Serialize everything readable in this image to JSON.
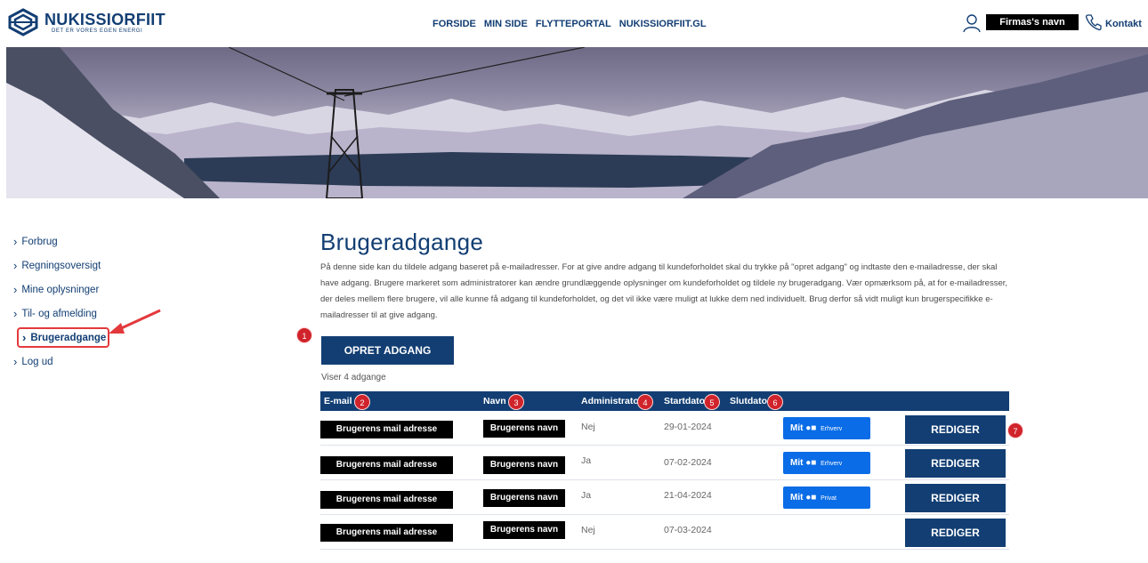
{
  "header": {
    "logo_name": "NUKISSIORFIIT",
    "logo_tagline": "DET ER VORES EGEN ENERGI",
    "nav": [
      "FORSIDE",
      "MIN SIDE",
      "FLYTTEPORTAL",
      "NUKISSIORFIIT.GL"
    ],
    "firm_name": "Firmas's navn",
    "contact": "Kontakt"
  },
  "sidebar": {
    "items": [
      {
        "label": "Forbrug"
      },
      {
        "label": "Regningsoversigt"
      },
      {
        "label": "Mine oplysninger"
      },
      {
        "label": "Til- og afmelding"
      },
      {
        "label": "Brugeradgange"
      },
      {
        "label": "Log ud"
      }
    ]
  },
  "main": {
    "title": "Brugeradgange",
    "intro": "På denne side kan du tildele adgang baseret på e-mailadresser. For at give andre adgang til kundeforholdet skal du trykke på \"opret adgang\" og indtaste den e-mailadresse, der skal have adgang. Brugere markeret som administratorer kan ændre grundlæggende oplysninger om kundeforholdet og tildele ny brugeradgang. Vær opmærksom på, at for e-mailadresser, der deles mellem flere brugere, vil alle kunne få adgang til kundeforholdet, og det vil ikke være muligt at lukke dem ned individuelt. Brug derfor så vidt muligt kun brugerspecifikke e-mailadresser til at give adgang.",
    "create_button": "OPRET ADGANG",
    "count_text": "Viser 4 adgange",
    "columns": [
      "E-mail",
      "Navn",
      "Administrator",
      "Startdato",
      "Slutdato"
    ],
    "rows": [
      {
        "email": "Brugerens mail adresse",
        "name": "Brugerens navn",
        "admin": "Nej",
        "start": "29-01-2024",
        "mitid_brand": "Mit",
        "mitid_kind": "Erhverv",
        "edit": "REDIGER"
      },
      {
        "email": "Brugerens mail adresse",
        "name": "Brugerens navn",
        "admin": "Ja",
        "start": "07-02-2024",
        "mitid_brand": "Mit",
        "mitid_kind": "Erhverv",
        "edit": "REDIGER"
      },
      {
        "email": "Brugerens mail adresse",
        "name": "Brugerens navn",
        "admin": "Ja",
        "start": "21-04-2024",
        "mitid_brand": "Mit",
        "mitid_kind": "Privat",
        "edit": "REDIGER"
      },
      {
        "email": "Brugerens mail adresse",
        "name": "Brugerens navn",
        "admin": "Nej",
        "start": "07-03-2024",
        "mitid_brand": "",
        "mitid_kind": "",
        "edit": "REDIGER"
      }
    ]
  },
  "annotations": [
    "1",
    "2",
    "3",
    "4",
    "5",
    "6",
    "7"
  ],
  "colors": {
    "brand": "#123e73",
    "mitid": "#0a6ce6",
    "annotation": "#d0232b"
  }
}
